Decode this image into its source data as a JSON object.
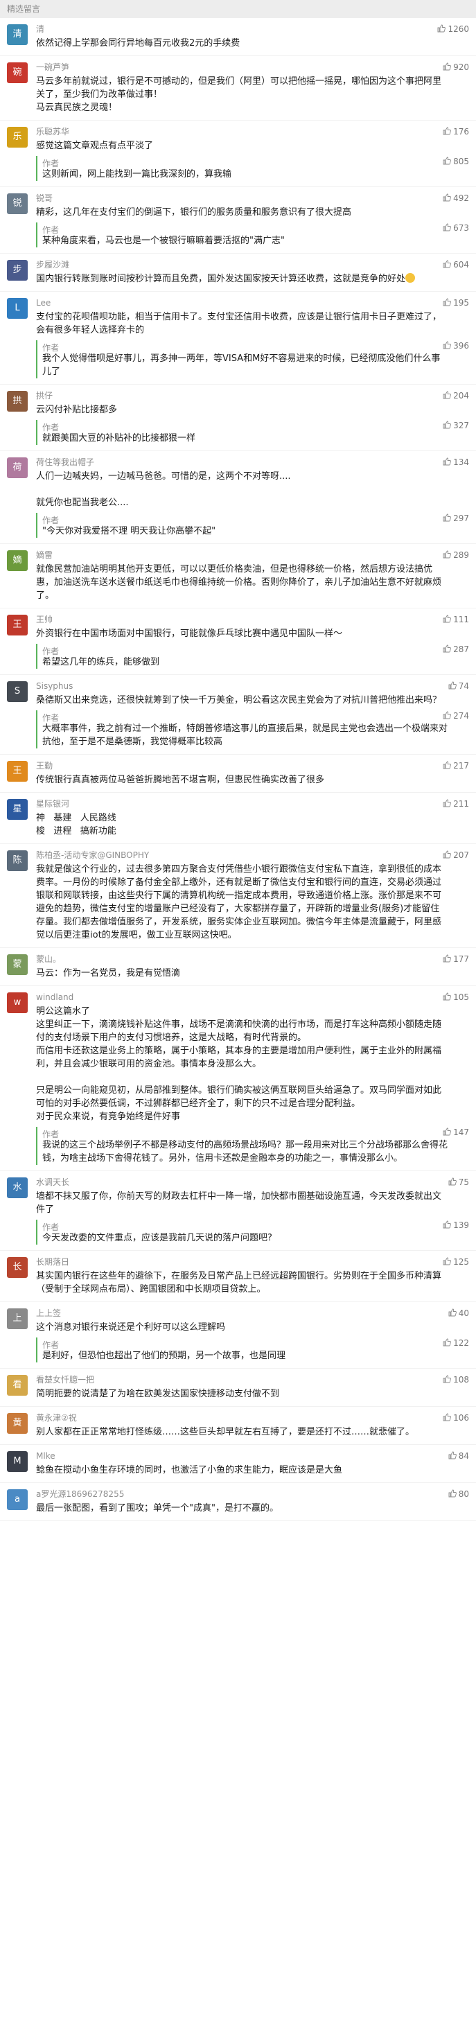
{
  "header": {
    "title": "精选留言"
  },
  "comments": [
    {
      "name": "清",
      "avatar": {
        "char": "清",
        "color": "#3c8cb4"
      },
      "likes": "1260",
      "text": "依然记得上学那会同行异地每百元收我2元的手续费",
      "reply": null
    },
    {
      "name": "一碗芦笋",
      "avatar": {
        "char": "碗",
        "color": "#c8372d"
      },
      "likes": "920",
      "text": "马云多年前就说过，银行是不可撼动的，但是我们（阿里）可以把他摇一摇晃，哪怕因为这个事把阿里关了，至少我们为改革做过事！\n马云真民族之灵魂！",
      "reply": null
    },
    {
      "name": "乐聪苏华",
      "avatar": {
        "char": "乐",
        "color": "#d4a017"
      },
      "likes": "176",
      "text": "感觉这篇文章观点有点平淡了",
      "reply": {
        "label": "作者",
        "likes": "805",
        "text": "这则新闻，网上能找到一篇比我深刻的，算我输"
      }
    },
    {
      "name": "锐哥",
      "avatar": {
        "char": "锐",
        "color": "#6b7c8c"
      },
      "likes": "492",
      "text": "精彩，这几年在支付宝们的倒逼下，银行们的服务质量和服务意识有了很大提高",
      "reply": {
        "label": "作者",
        "likes": "673",
        "text": "某种角度来看，马云也是一个被银行嘛嘛着要活抠的\"满广志\""
      }
    },
    {
      "name": "步履沙滩",
      "avatar": {
        "char": "步",
        "color": "#4a5a8c"
      },
      "likes": "604",
      "text": "国内银行转账到账时间按秒计算而且免费，国外发达国家按天计算还收费，这就是竞争的好处",
      "emoji": true,
      "reply": null
    },
    {
      "name": "Lee",
      "avatar": {
        "char": "L",
        "color": "#2f7dc1"
      },
      "likes": "195",
      "text": "支付宝的花呗借呗功能，相当于信用卡了。支付宝还信用卡收费，应该是让银行信用卡日子更难过了，会有很多年轻人选择弃卡的",
      "reply": {
        "label": "作者",
        "likes": "396",
        "text": "我个人觉得借呗是好事儿，再多抻一两年，等VISA和M好不容易进来的时候，已经彻底没他们什么事儿了"
      }
    },
    {
      "name": "拱仔",
      "avatar": {
        "char": "拱",
        "color": "#8b5a3c"
      },
      "likes": "204",
      "text": "云闪付补贴比接都多",
      "reply": {
        "label": "作者",
        "likes": "327",
        "text": "就跟美国大豆的补贴补的比接都狠一样"
      }
    },
    {
      "name": "荷住等我出帽子",
      "avatar": {
        "char": "荷",
        "color": "#b07a9e"
      },
      "likes": "134",
      "text": "人们一边喊夹妈，一边喊马爸爸。可惜的是，这两个不对等呀....\n\n就凭你也配当我老公....",
      "reply": {
        "label": "作者",
        "likes": "297",
        "text": "\"今天你对我爱搭不理 明天我让你高攀不起\""
      }
    },
    {
      "name": "嫡雷",
      "avatar": {
        "char": "嫡",
        "color": "#6c9a3c"
      },
      "likes": "289",
      "text": "就像民营加油站明明其他开支更低，可以以更低价格卖油，但是也得移统一价格，然后想方设法搞优惠，加油送洗车送水送餐巾纸送毛巾也得维持统一价格。否则你降价了，亲儿子加油站生意不好就麻烦了。",
      "reply": null
    },
    {
      "name": "王帅",
      "avatar": {
        "char": "王",
        "color": "#c0392b"
      },
      "likes": "111",
      "text": "外资银行在中国市场面对中国银行，可能就像乒乓球比赛中遇见中国队一样～",
      "reply": {
        "label": "作者",
        "likes": "287",
        "text": "希望这几年的练兵，能够做到"
      }
    },
    {
      "name": "Sisyphus",
      "avatar": {
        "char": "S",
        "color": "#444a52"
      },
      "likes": "74",
      "text": "桑德斯又出来竞选，还很快就筹到了快一千万美金，明公看这次民主党会为了对抗川普把他推出来吗？",
      "reply": {
        "label": "作者",
        "likes": "274",
        "text": "大概率事件，我之前有过一个推断，特朗普修墙这事儿的直接后果，就是民主党也会选出一个极端来对抗他，至于是不是桑德斯，我觉得概率比较高"
      }
    },
    {
      "name": "王勤",
      "avatar": {
        "char": "王",
        "color": "#e08a1e"
      },
      "likes": "217",
      "text": "传统银行真真被两位马爸爸折腾地苦不堪言啊，但惠民性确实改善了很多",
      "reply": null
    },
    {
      "name": "星际银河",
      "avatar": {
        "char": "星",
        "color": "#2c5aa0"
      },
      "likes": "211",
      "text": "神   基建   人民路线\n梭   进程   搞新功能",
      "reply": null
    },
    {
      "name": "陈柏丞-活动专家@GINBOPHY",
      "avatar": {
        "char": "陈",
        "color": "#5b6b7b"
      },
      "likes": "207",
      "text": "我就是做这个行业的，过去很多第四方聚合支付凭借些小银行跟微信支付宝私下直连，拿到很低的成本费率。一月份的时候除了备付金全部上缴外，还有就是断了微信支付宝和银行间的直连，交易必须通过银联和网联转接，由这些央行下属的清算机构统一指定成本费用，导致通道价格上涨。涨价那是来不可避免的趋势，微信支付宝的增量账户已经没有了，大家都拼存量了，开辟新的增量业务(服务)才能留住存量。我们都去做增值服务了，开发系统，服务实体企业互联网加。微信今年主体是流量藏于，阿里感觉以后更注重iot的发展吧，做工业互联网这快吧。",
      "reply": null
    },
    {
      "name": "蒙山。",
      "avatar": {
        "char": "蒙",
        "color": "#7a9a5c"
      },
      "likes": "177",
      "text": "马云：作为一名党员，我是有觉悟滴",
      "reply": null
    },
    {
      "name": "windland",
      "avatar": {
        "char": "w",
        "color": "#c0392b"
      },
      "likes": "105",
      "text": "明公这篇水了\n这里纠正一下，滴滴烧钱补贴这件事，战场不是滴滴和快滴的出行市场，而是打车这种高频小额随走随付的支付场景下用户的支付习惯培养，这是大战略，有时代背景的。\n而信用卡还款这是业务上的策略，属于小策略，其本身的主要是增加用户便利性，属于主业外的附属福利，并且会减少银联可用的资金池。事情本身没那么大。\n\n只是明公一向能窥见初，从局部推到整体。银行们确实被这俩互联网巨头给逼急了。双马同学面对如此可怕的对手必然要低调，不过狮群都已经齐全了，剩下的只不过是合理分配利益。\n对于民众来说，有竞争始终是件好事",
      "reply": {
        "label": "作者",
        "likes": "147",
        "text": "我说的这三个战场举例子不都是移动支付的高频场景战场吗？那一段用来对比三个分战场都那么舍得花钱，为啥主战场下舍得花钱了。另外，信用卡还款是金融本身的功能之一，事情没那么小。"
      }
    },
    {
      "name": "水调天长",
      "avatar": {
        "char": "水",
        "color": "#3c7ab4"
      },
      "likes": "75",
      "text": "墙都不抹又服了你，你前天写的财政去杠杆中一降一增，加快都市圈基础设施互通，今天发改委就出文件了",
      "reply": {
        "label": "作者",
        "likes": "139",
        "text": "今天发改委的文件重点，应该是我前几天说的落户问题吧?"
      }
    },
    {
      "name": "长期落日",
      "avatar": {
        "char": "长",
        "color": "#b8452e"
      },
      "likes": "125",
      "text": "其实国内银行在这些年的避徐下，在服务及日常产品上已经远超跨国银行。劣势则在于全国多币种清算（受制于全球网点布局）、跨国银团和中长期项目贷款上。",
      "reply": null
    },
    {
      "name": "上上签",
      "avatar": {
        "char": "上",
        "color": "#8a8a8a"
      },
      "likes": "40",
      "text": "这个消息对银行来说还是个利好可以这么理解吗",
      "reply": {
        "label": "作者",
        "likes": "122",
        "text": "是利好，但恐怕也超出了他们的预期，另一个故事，也是同理"
      }
    },
    {
      "name": "看楚女忏臆一把",
      "avatar": {
        "char": "看",
        "color": "#d4a84a"
      },
      "likes": "108",
      "text": "简明扼要的说清楚了为啥在欧美发达国家快捷移动支付做不到",
      "reply": null
    },
    {
      "name": "黄永津②祝",
      "avatar": {
        "char": "黄",
        "color": "#c97a3a"
      },
      "likes": "106",
      "text": "别人家都在正正常常地打怪练级……这些巨头却早就左右互搏了，要是还打不过……就悲催了。",
      "reply": null
    },
    {
      "name": "Mlke",
      "avatar": {
        "char": "M",
        "color": "#3a3f4a"
      },
      "likes": "84",
      "text": "鲶鱼在搅动小鱼生存环境的同时，也激活了小鱼的求生能力，眠应该是是大鱼",
      "reply": null
    },
    {
      "name": "a罗光源18696278255",
      "avatar": {
        "char": "a",
        "color": "#4a8ac4"
      },
      "likes": "80",
      "text": "最后一张配图，看到了围攻；单凭一个\"成真\"，是打不赢的。",
      "reply": null
    }
  ]
}
